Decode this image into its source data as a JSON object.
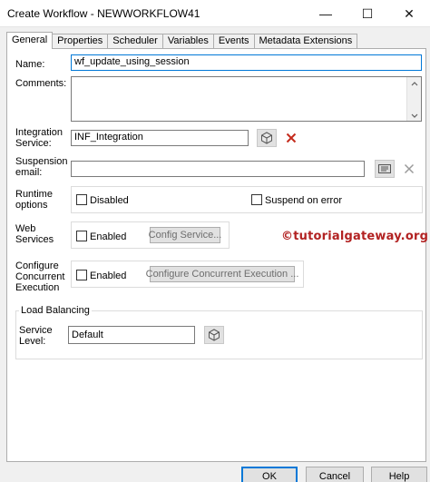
{
  "window": {
    "title": "Create Workflow - NEWWORKFLOW41",
    "minimize_glyph": "—",
    "maximize_glyph": "☐",
    "close_glyph": "✕"
  },
  "tabs": [
    {
      "label": "General",
      "active": true
    },
    {
      "label": "Properties"
    },
    {
      "label": "Scheduler"
    },
    {
      "label": "Variables"
    },
    {
      "label": "Events"
    },
    {
      "label": "Metadata Extensions"
    }
  ],
  "form": {
    "name_label": "Name:",
    "name_value": "wf_update_using_session",
    "comments_label": "Comments:",
    "comments_value": "",
    "integration_label_1": "Integration",
    "integration_label_2": "Service:",
    "integration_value": "INF_Integration",
    "suspension_label_1": "Suspension",
    "suspension_label_2": "email:",
    "suspension_value": "",
    "runtime_label_1": "Runtime",
    "runtime_label_2": "options",
    "disabled_label": "Disabled",
    "suspend_on_error_label": "Suspend on error",
    "web_label_1": "Web",
    "web_label_2": "Services",
    "web_enabled_label": "Enabled",
    "config_service_label": "Config Service...",
    "concurrent_label_1": "Configure",
    "concurrent_label_2": "Concurrent",
    "concurrent_label_3": "Execution",
    "concurrent_enabled_label": "Enabled",
    "configure_concurrent_label": "Configure Concurrent Execution ...",
    "load_balancing_label": "Load Balancing",
    "service_level_label_1": "Service",
    "service_level_label_2": "Level:",
    "service_level_value": "Default"
  },
  "watermark": "©tutorialgateway.org",
  "footer": {
    "ok_label": "OK",
    "cancel_label": "Cancel",
    "help_label": "Help"
  },
  "icons": {
    "browse": "cube-icon",
    "clear": "red-x-icon",
    "email": "email-icon"
  },
  "colors": {
    "focus_border": "#0078d7",
    "clear_x": "#c42b1c",
    "watermark": "#b22222"
  }
}
